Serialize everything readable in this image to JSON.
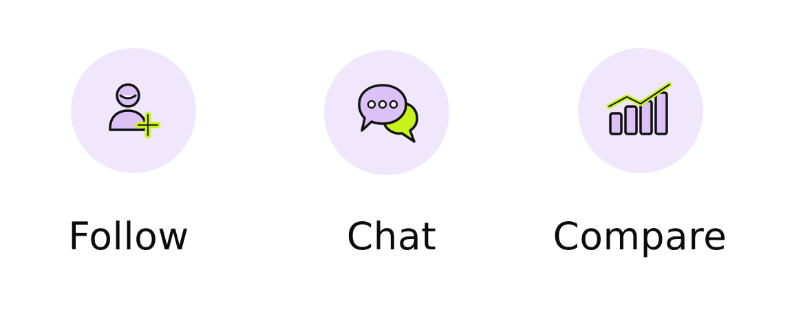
{
  "features": [
    {
      "label": "Follow",
      "icon": "add-user-icon"
    },
    {
      "label": "Chat",
      "icon": "chat-bubbles-icon"
    },
    {
      "label": "Compare",
      "icon": "bar-chart-trend-icon"
    }
  ],
  "colors": {
    "circle_bg": "#f0e7fd",
    "icon_purple": "#dcc1f7",
    "icon_lime": "#c8f21c",
    "outline": "#111111",
    "text": "#0b0b0b"
  }
}
